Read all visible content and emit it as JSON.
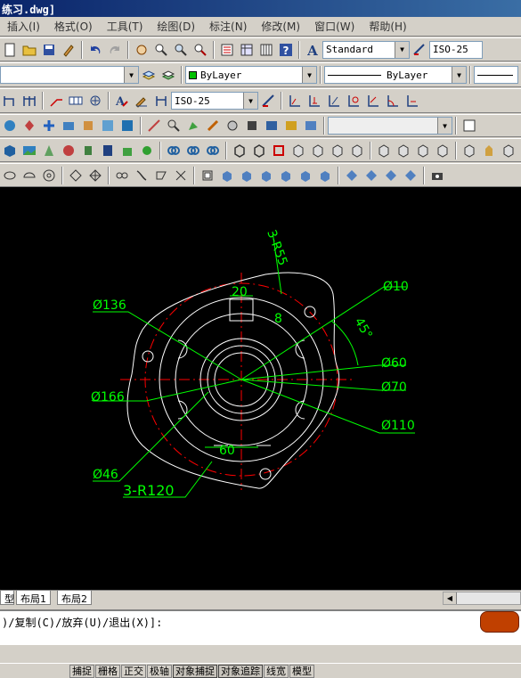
{
  "title": "练习.dwg]",
  "menu": [
    "插入(I)",
    "格式(O)",
    "工具(T)",
    "绘图(D)",
    "标注(N)",
    "修改(M)",
    "窗口(W)",
    "帮助(H)"
  ],
  "toolbar": {
    "text_style": "Standard",
    "dim_style": "ISO-25",
    "dim_style2": "ISO-25",
    "layer_color": "ByLayer",
    "layer_linetype": "ByLayer"
  },
  "drawing": {
    "dims": {
      "d136": "Ø136",
      "d166": "Ø166",
      "d46": "Ø46",
      "r120": "3-R120",
      "w20": "20",
      "w8": "8",
      "r55": "3-R55",
      "d10": "Ø10",
      "ang45": "45°",
      "d60": "Ø60",
      "d70": "Ø70",
      "d110": "Ø110",
      "w60": "60"
    },
    "colors": {
      "background": "#000000",
      "dimension": "#00ff00",
      "geometry": "#ffffff",
      "centerline": "#ff0000"
    }
  },
  "layout_tabs": [
    "型",
    "布局1",
    "布局2"
  ],
  "command_line": ")/复制(C)/放弃(U)/退出(X)]:",
  "status_buttons": [
    "捕捉",
    "栅格",
    "正交",
    "极轴",
    "对象捕捉",
    "对象追踪",
    "线宽",
    "模型"
  ]
}
